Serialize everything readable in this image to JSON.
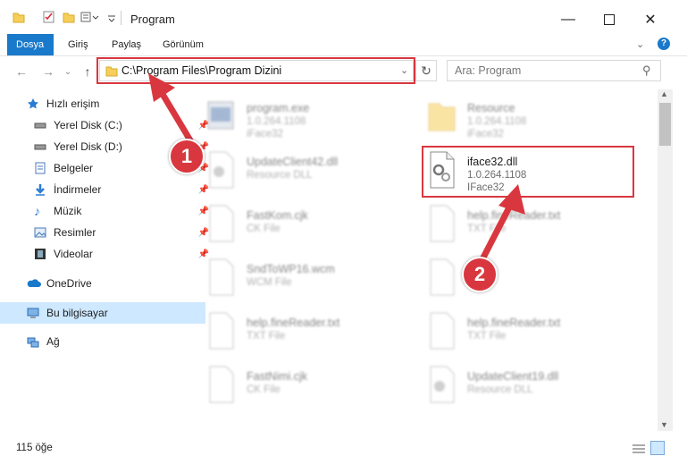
{
  "window": {
    "title": "Program"
  },
  "ribbon": {
    "tabs": [
      "Dosya",
      "Giriş",
      "Paylaş",
      "Görünüm"
    ]
  },
  "nav": {
    "address": "C:\\Program Files\\Program Dizini",
    "search_placeholder": "Ara: Program"
  },
  "sidebar": {
    "items": [
      {
        "label": "Hızlı erişim"
      },
      {
        "label": "Yerel Disk (C:)"
      },
      {
        "label": "Yerel Disk (D:)"
      },
      {
        "label": "Belgeler"
      },
      {
        "label": "İndirmeler"
      },
      {
        "label": "Müzik"
      },
      {
        "label": "Resimler"
      },
      {
        "label": "Videolar"
      },
      {
        "label": "OneDrive"
      },
      {
        "label": "Bu bilgisayar"
      },
      {
        "label": "Ağ"
      }
    ]
  },
  "files": [
    {
      "name": "program.exe",
      "line2": "1.0.264.1108",
      "line3": "iFace32"
    },
    {
      "name": "Resource",
      "line2": "1.0.264.1108",
      "line3": "iFace32"
    },
    {
      "name": "UpdateClient42.dll",
      "line2": "Resource DLL"
    },
    {
      "name": "iface32.dll",
      "line2": "1.0.264.1108",
      "line3": "IFace32"
    },
    {
      "name": "FastKom.cjk",
      "line2": "CK File"
    },
    {
      "name": "help.fineReader.txt",
      "line2": "TXT File"
    },
    {
      "name": "SndToWP16.wcm",
      "line2": "WCM File"
    },
    {
      "name": "",
      "line2": ""
    },
    {
      "name": "help.fineReader.txt",
      "line2": "TXT File"
    },
    {
      "name": "help.fineReader.txt",
      "line2": "TXT File"
    },
    {
      "name": "FastNimi.cjk",
      "line2": "CK File"
    },
    {
      "name": "UpdateClient19.dll",
      "line2": "Resource DLL"
    }
  ],
  "status": {
    "count": "115 öğe"
  },
  "annotations": {
    "badge1": "1",
    "badge2": "2"
  },
  "colors": {
    "accent": "#1979ca",
    "annotation": "#d9373f",
    "selected": "#cde8ff"
  }
}
